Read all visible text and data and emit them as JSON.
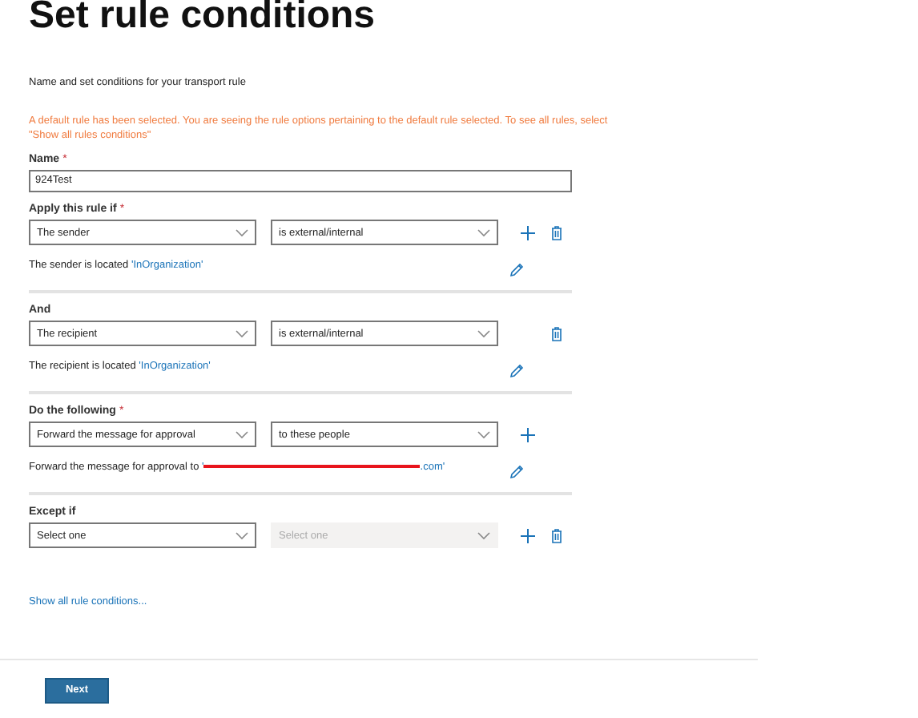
{
  "title": "Set rule conditions",
  "subtitle": "Name and set conditions for your transport rule",
  "warning": "A default rule has been selected. You are seeing the rule options pertaining to the default rule selected. To see all rules, select \"Show all rules conditions\"",
  "name_field": {
    "label": "Name",
    "required_mark": "*",
    "value": "924Test"
  },
  "sections": [
    {
      "label": "Apply this rule if",
      "required_mark": "*",
      "condition": {
        "value": "The sender",
        "disabled": false
      },
      "operator": {
        "value": "is external/internal",
        "disabled": false
      },
      "add": true,
      "delete": true,
      "detail": "The sender is located ",
      "link": "'InOrganization'",
      "edit": true,
      "divider": true
    },
    {
      "label": "And",
      "condition": {
        "value": "The recipient",
        "disabled": false
      },
      "operator": {
        "value": "is external/internal",
        "disabled": false
      },
      "add": false,
      "delete": true,
      "detail": "The recipient is located ",
      "link": "'InOrganization'",
      "edit": true,
      "divider": true
    },
    {
      "label": "Do the following",
      "required_mark": "*",
      "condition": {
        "value": "Forward the message for approval",
        "disabled": false
      },
      "operator": {
        "value": "to these people",
        "disabled": false
      },
      "add": true,
      "delete": false,
      "detail": "Forward the message for approval to ",
      "link": "'",
      "redacted": true,
      "link_end": ".com'",
      "edit": true,
      "divider": true
    },
    {
      "label": "Except if",
      "condition": {
        "value": "Select one",
        "disabled": false
      },
      "operator": {
        "value": "Select one",
        "disabled": true
      },
      "add": true,
      "delete": true,
      "divider": false
    }
  ],
  "show_all_link": "Show all rule conditions...",
  "next_button": "Next"
}
